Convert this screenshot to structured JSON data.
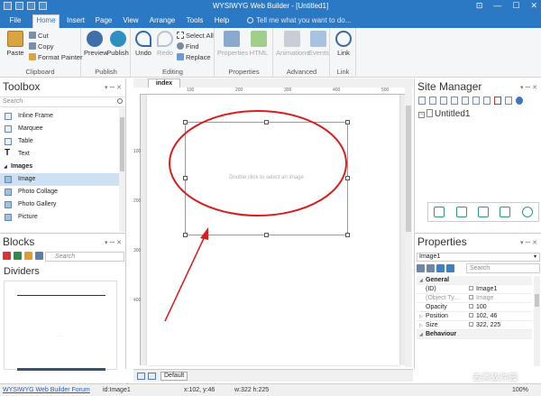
{
  "window": {
    "title": "WYSIWYG Web Builder - [Untitled1]",
    "minimize": "—",
    "maximize": "☐",
    "close": "✕",
    "ribbon_toggle": "⊡"
  },
  "tabs": [
    {
      "label": "File"
    },
    {
      "label": "Home"
    },
    {
      "label": "Insert"
    },
    {
      "label": "Page"
    },
    {
      "label": "View"
    },
    {
      "label": "Arrange"
    },
    {
      "label": "Tools"
    },
    {
      "label": "Help"
    }
  ],
  "tell_me": "Tell me what you want to do...",
  "ribbon": {
    "clipboard": {
      "label": "Clipboard",
      "paste": "Paste",
      "cut": "Cut",
      "copy": "Copy",
      "format_painter": "Format Painter"
    },
    "publish": {
      "label": "Publish",
      "preview": "Preview",
      "publish": "Publish"
    },
    "editing": {
      "label": "Editing",
      "undo": "Undo",
      "redo": "Redo",
      "select_all": "Select All",
      "find": "Find",
      "replace": "Replace"
    },
    "properties": {
      "label": "Properties",
      "properties": "Properties",
      "html": "HTML"
    },
    "advanced": {
      "label": "Advanced",
      "animations": "Animations",
      "events": "Events"
    },
    "link": {
      "label": "Link",
      "link": "Link"
    }
  },
  "toolbox": {
    "title": "Toolbox",
    "search_placeholder": "Search",
    "items": [
      {
        "label": "Inline Frame"
      },
      {
        "label": "Marquee"
      },
      {
        "label": "Table"
      },
      {
        "label": "Text"
      },
      {
        "label": "Images"
      },
      {
        "label": "Image"
      },
      {
        "label": "Photo Collage"
      },
      {
        "label": "Photo Gallery"
      },
      {
        "label": "Picture"
      }
    ]
  },
  "blocks": {
    "title": "Blocks",
    "search_placeholder": "Search",
    "category": "Dividers"
  },
  "document": {
    "tab": "index",
    "ruler_top": [
      "100",
      "200",
      "300",
      "400",
      "500"
    ],
    "ruler_left": [
      "100",
      "200",
      "300",
      "400"
    ],
    "image_hint": "Double click to select an image",
    "page_tab": "Default"
  },
  "site_manager": {
    "title": "Site Manager",
    "root": "Untitled1"
  },
  "properties": {
    "title": "Properties",
    "object": "Image1",
    "search_placeholder": "Search",
    "rows": [
      {
        "key": "General",
        "value": "",
        "group": true
      },
      {
        "key": "(ID)",
        "value": "Image1"
      },
      {
        "key": "(Object Ty...",
        "value": "Image"
      },
      {
        "key": "Opacity",
        "value": "100"
      },
      {
        "key": "Position",
        "value": "102, 46"
      },
      {
        "key": "Size",
        "value": "322, 225"
      },
      {
        "key": "Behaviour",
        "value": "",
        "group": true
      }
    ]
  },
  "statusbar": {
    "forum": "WYSIWYG Web Builder Forum",
    "id": "id:Image1",
    "pos": "x:102, y:46",
    "size": "w:322 h:225",
    "zoom": "100%"
  },
  "watermark": "去秀软件园",
  "colors": {
    "accent": "#2b78c5",
    "annotation": "#d81e1e",
    "selection": "#cde0f4",
    "site_actions": "#2a9d6e"
  }
}
